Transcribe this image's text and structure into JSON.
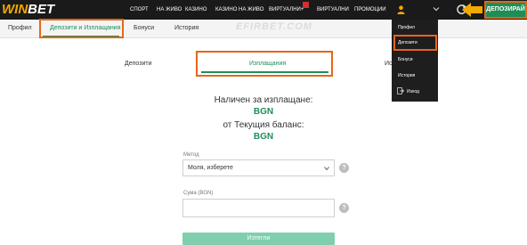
{
  "brand": {
    "logo_part1": "WIN",
    "logo_part2": "BET"
  },
  "nav": {
    "items": [
      "СПОРТ",
      "НА ЖИВО",
      "КАЗИНО",
      "КАЗИНО НА ЖИВО",
      "ВИРТУАЛНИ+",
      "ВИРТУАЛНИ",
      "ПРОМОЦИИ"
    ],
    "deposit_button": "ДЕПОЗИРАЙ"
  },
  "subnav": {
    "tabs": [
      "Профил",
      "Депозити и Изплащания",
      "Бонуси",
      "История"
    ],
    "active_index": 1
  },
  "watermark": "EFIRBET.COM",
  "inner_tabs": {
    "deposits": "Депозити",
    "withdrawals": "Изплащания",
    "history": "Ис"
  },
  "balance": {
    "available_label": "Наличен за изплащане:",
    "available_currency": "BGN",
    "current_label": "от Текущия баланс:",
    "current_currency": "BGN"
  },
  "form": {
    "method_label": "Метод",
    "method_value": "Моля, изберете",
    "amount_label": "Сума (BGN)",
    "amount_value": "",
    "help_symbol": "?",
    "submit_label": "Изтегли"
  },
  "user_menu": {
    "items": [
      "Профил",
      "Депозити",
      "Бонуси",
      "История",
      "Изход"
    ],
    "highlighted_index": 1
  },
  "colors": {
    "accent": "#1e8e57",
    "annotation": "#e8641a",
    "brand": "#f2a900"
  }
}
